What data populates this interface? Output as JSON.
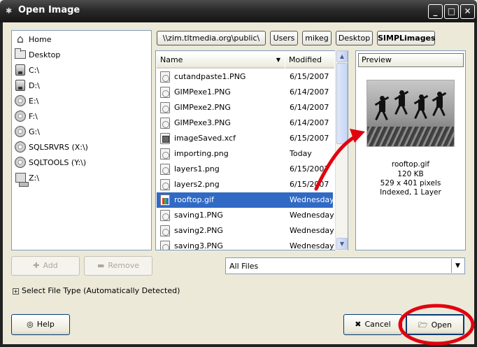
{
  "window": {
    "title": "Open Image",
    "controls": {
      "minimize": "_",
      "maximize": "□",
      "close": "✕"
    }
  },
  "places": [
    {
      "label": "Home",
      "icon": "home-icon"
    },
    {
      "label": "Desktop",
      "icon": "folder-icon"
    },
    {
      "label": "C:\\",
      "icon": "drive-icon"
    },
    {
      "label": "D:\\",
      "icon": "drive-icon"
    },
    {
      "label": "E:\\",
      "icon": "cd-icon"
    },
    {
      "label": "F:\\",
      "icon": "cd-icon"
    },
    {
      "label": "G:\\",
      "icon": "cd-icon"
    },
    {
      "label": "SQLSRVRS (X:\\)",
      "icon": "cd-icon"
    },
    {
      "label": "SQLTOOLS (Y:\\)",
      "icon": "cd-icon"
    },
    {
      "label": "Z:\\",
      "icon": "network-drive-icon"
    }
  ],
  "path": [
    {
      "label": "\\\\zim.tltmedia.org\\public\\"
    },
    {
      "label": "Users"
    },
    {
      "label": "mikeg"
    },
    {
      "label": "Desktop"
    },
    {
      "label": "SIMPLimages",
      "active": true
    }
  ],
  "file_list": {
    "columns": {
      "name": "Name",
      "modified": "Modified",
      "sort_indicator": "▼"
    },
    "rows": [
      {
        "name": "cutandpaste1.PNG",
        "modified": "6/15/2007",
        "type": "png"
      },
      {
        "name": "GIMPexe1.PNG",
        "modified": "6/14/2007",
        "type": "png"
      },
      {
        "name": "GIMPexe2.PNG",
        "modified": "6/14/2007",
        "type": "png"
      },
      {
        "name": "GIMPexe3.PNG",
        "modified": "6/14/2007",
        "type": "png"
      },
      {
        "name": "imageSaved.xcf",
        "modified": "6/15/2007",
        "type": "xcf"
      },
      {
        "name": "importing.png",
        "modified": "Today",
        "type": "png"
      },
      {
        "name": "layers1.png",
        "modified": "6/15/2007",
        "type": "png"
      },
      {
        "name": "layers2.png",
        "modified": "6/15/2007",
        "type": "png"
      },
      {
        "name": "rooftop.gif",
        "modified": "Wednesday",
        "type": "gif",
        "selected": true
      },
      {
        "name": "saving1.PNG",
        "modified": "Wednesday",
        "type": "png"
      },
      {
        "name": "saving2.PNG",
        "modified": "Wednesday",
        "type": "png"
      },
      {
        "name": "saving3.PNG",
        "modified": "Wednesday",
        "type": "png"
      }
    ]
  },
  "preview": {
    "header": "Preview",
    "filename": "rooftop.gif",
    "size": "120 KB",
    "dimensions": "529 x 401 pixels",
    "mode": "Indexed, 1 Layer"
  },
  "buttons": {
    "add": "Add",
    "remove": "Remove",
    "help": "Help",
    "cancel": "Cancel",
    "open": "Open"
  },
  "filter": {
    "value": "All Files"
  },
  "file_type_expander": {
    "label": "Select File Type (Automatically Detected)"
  },
  "colors": {
    "selection": "#316ac5",
    "annotation": "#e3000f"
  }
}
